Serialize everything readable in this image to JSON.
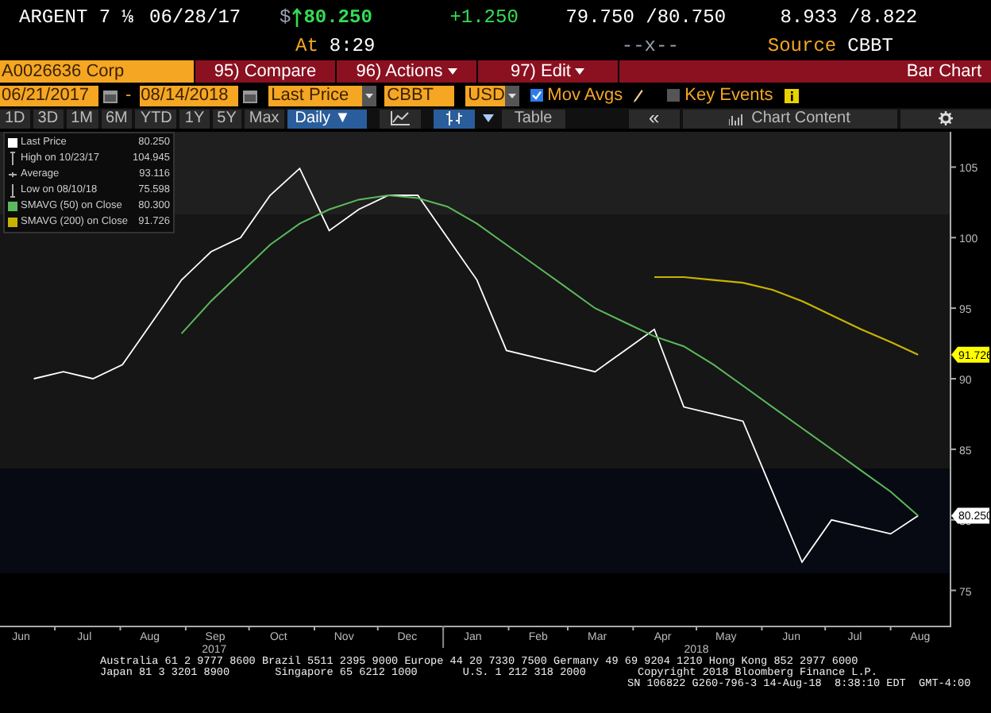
{
  "quote": {
    "security": "ARGENT 7 ⅛",
    "date": "06/28/17",
    "currency": "$",
    "price": "80.250",
    "change": "+1.250",
    "bid_ask": "79.750 /80.750",
    "yields": "8.933 /8.822",
    "time_label": "At",
    "time": "8:29",
    "size": "--x--",
    "source_label": "Source",
    "source": "CBBT"
  },
  "command_bar": {
    "ticker": "A0026636 Corp",
    "buttons": [
      {
        "label": "95) Compare",
        "dropdown": false
      },
      {
        "label": "96) Actions",
        "dropdown": true
      },
      {
        "label": "97) Edit",
        "dropdown": true
      }
    ],
    "title": "Bar Chart"
  },
  "settings": {
    "start_date": "06/21/2017",
    "separator": "-",
    "end_date": "08/14/2018",
    "field": "Last Price",
    "source": "CBBT",
    "currency": "USD",
    "options": [
      {
        "label": "Mov Avgs",
        "checked": true,
        "editable": true
      },
      {
        "label": "Key Events",
        "checked": false,
        "editable": false
      }
    ]
  },
  "toolbar": {
    "ranges": [
      {
        "label": "1D",
        "selected": false
      },
      {
        "label": "3D",
        "selected": false
      },
      {
        "label": "1M",
        "selected": false
      },
      {
        "label": "6M",
        "selected": false
      },
      {
        "label": "YTD",
        "selected": false
      },
      {
        "label": "1Y",
        "selected": false
      },
      {
        "label": "5Y",
        "selected": false
      },
      {
        "label": "Max",
        "selected": false
      }
    ],
    "period": {
      "label": "Daily ▼",
      "selected": true
    },
    "chart_types": [
      {
        "kind": "line",
        "selected": false
      },
      {
        "kind": "bar",
        "selected": true
      }
    ],
    "table": "Table",
    "collapse": "«",
    "chart_content": "Chart Content"
  },
  "legend": {
    "items": [
      {
        "kind": "series",
        "value": "80.250"
      },
      {
        "kind": "high",
        "label": "High on 10/23/17",
        "value": "104.945"
      },
      {
        "kind": "average",
        "label": "Average",
        "value": "93.116"
      },
      {
        "kind": "low",
        "label": "Low on 08/10/18",
        "value": "75.598"
      },
      {
        "kind": "series",
        "value": "80.300"
      },
      {
        "kind": "series",
        "value": "91.726"
      }
    ]
  },
  "chart": {
    "value_tags": [
      {
        "label": "91.726",
        "kind": "long_average"
      },
      {
        "label": "80.250",
        "kind": "price"
      }
    ],
    "years": [
      "2017",
      "2018"
    ],
    "chart_data": {
      "type": "line",
      "x": [
        "2017-06-21",
        "2017-07-05",
        "2017-07-19",
        "2017-08-02",
        "2017-08-16",
        "2017-08-30",
        "2017-09-13",
        "2017-09-27",
        "2017-10-11",
        "2017-10-25",
        "2017-11-08",
        "2017-11-22",
        "2017-12-06",
        "2017-12-20",
        "2018-01-03",
        "2018-01-17",
        "2018-01-31",
        "2018-02-14",
        "2018-02-28",
        "2018-03-14",
        "2018-03-28",
        "2018-04-11",
        "2018-04-25",
        "2018-05-09",
        "2018-05-23",
        "2018-06-06",
        "2018-06-20",
        "2018-07-04",
        "2018-07-18",
        "2018-08-01",
        "2018-08-14"
      ],
      "series": [
        {
          "name": "Last Price",
          "color": "#ffffff",
          "values": [
            90,
            90.5,
            90,
            91,
            94,
            97,
            99,
            100,
            103,
            104.9,
            100.5,
            102,
            103,
            103,
            100,
            97,
            92,
            91.5,
            91,
            90.5,
            92,
            93.5,
            88,
            87.5,
            87,
            82,
            77,
            80,
            79.5,
            79,
            80.3
          ]
        },
        {
          "name": "SMAVG (50) on Close",
          "color": "#5cb85c",
          "values": [
            null,
            null,
            null,
            null,
            null,
            93.2,
            95.5,
            97.5,
            99.5,
            101,
            102,
            102.7,
            103,
            102.8,
            102.2,
            101,
            99.5,
            98,
            96.5,
            95,
            94,
            93,
            92.3,
            91,
            89.5,
            88,
            86.5,
            85,
            83.5,
            82,
            80.3
          ]
        },
        {
          "name": "SMAVG (200) on Close",
          "color": "#c8b400",
          "values": [
            null,
            null,
            null,
            null,
            null,
            null,
            null,
            null,
            null,
            null,
            null,
            null,
            null,
            null,
            null,
            null,
            null,
            null,
            null,
            null,
            null,
            97.2,
            97.2,
            97,
            96.8,
            96.3,
            95.5,
            94.5,
            93.5,
            92.6,
            91.7
          ]
        }
      ],
      "legend": "upper left",
      "xticks": [
        {
          "value": "2017-06-15",
          "label": "Jun"
        },
        {
          "value": "2017-07-15",
          "label": "Jul"
        },
        {
          "value": "2017-08-15",
          "label": "Aug"
        },
        {
          "value": "2017-09-15",
          "label": "Sep"
        },
        {
          "value": "2017-10-15",
          "label": "Oct"
        },
        {
          "value": "2017-11-15",
          "label": "Nov"
        },
        {
          "value": "2017-12-15",
          "label": "Dec"
        },
        {
          "value": "2018-01-15",
          "label": "Jan"
        },
        {
          "value": "2018-02-15",
          "label": "Feb"
        },
        {
          "value": "2018-03-15",
          "label": "Mar"
        },
        {
          "value": "2018-04-15",
          "label": "Apr"
        },
        {
          "value": "2018-05-15",
          "label": "May"
        },
        {
          "value": "2018-06-15",
          "label": "Jun"
        },
        {
          "value": "2018-07-15",
          "label": "Jul"
        },
        {
          "value": "2018-08-15",
          "label": "Aug"
        }
      ],
      "xlim": [
        "2017-06-05",
        "2018-08-29"
      ],
      "yticks": [
        75,
        80,
        85,
        90,
        95,
        100,
        105
      ],
      "ylim": [
        72.5,
        107.5
      ]
    }
  },
  "footer": {
    "lines": [
      "Australia 61 2 9777 8600 Brazil 5511 2395 9000 Europe 44 20 7330 7500 Germany 49 69 9204 1210 Hong Kong 852 2977 6000",
      "Japan 81 3 3201 8900       Singapore 65 6212 1000       U.S. 1 212 318 2000        Copyright 2018 Bloomberg Finance L.P.",
      "SN 106822 G260-796-3 14-Aug-18  8:38:10 EDT  GMT-4:00"
    ]
  }
}
